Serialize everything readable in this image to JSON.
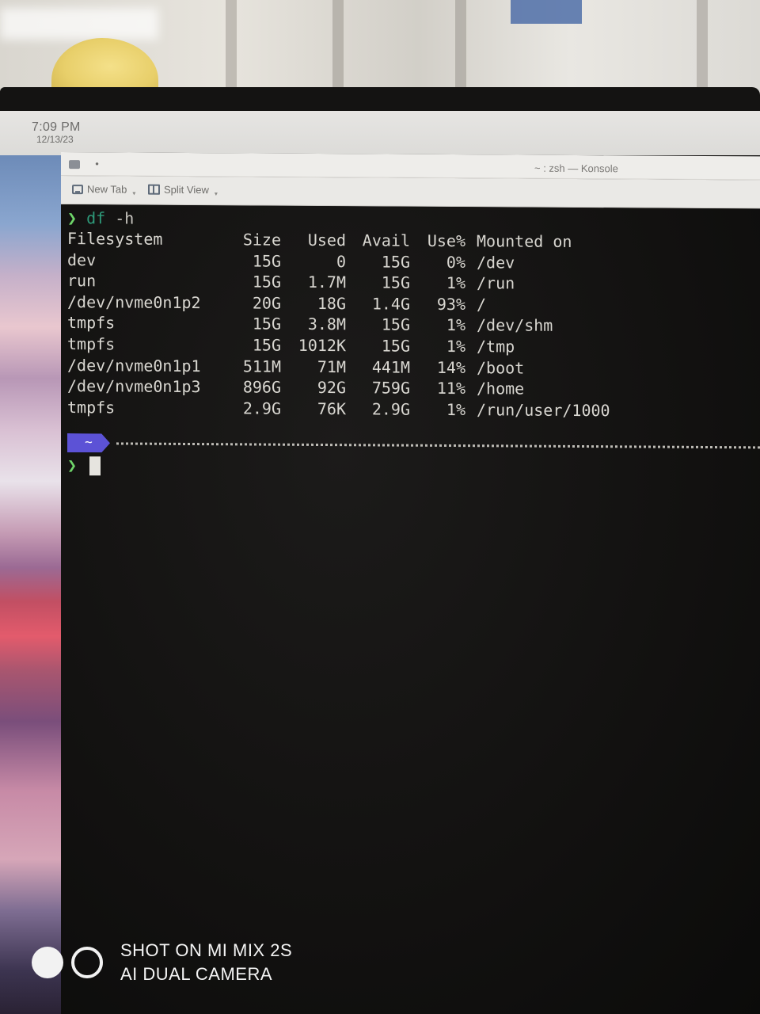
{
  "clock": {
    "time": "7:09 PM",
    "date": "12/13/23"
  },
  "window": {
    "title": "~ : zsh — Konsole"
  },
  "toolbar": {
    "new_tab": "New Tab",
    "split_view": "Split View"
  },
  "terminal": {
    "prompt_symbol": "❯",
    "command": {
      "name": "df",
      "args": "-h"
    },
    "df_header": [
      "Filesystem",
      "Size",
      "Used",
      "Avail",
      "Use%",
      "Mounted on"
    ],
    "df_rows": [
      [
        "dev",
        "15G",
        "0",
        "15G",
        "0%",
        "/dev"
      ],
      [
        "run",
        "15G",
        "1.7M",
        "15G",
        "1%",
        "/run"
      ],
      [
        "/dev/nvme0n1p2",
        "20G",
        "18G",
        "1.4G",
        "93%",
        "/"
      ],
      [
        "tmpfs",
        "15G",
        "3.8M",
        "15G",
        "1%",
        "/dev/shm"
      ],
      [
        "tmpfs",
        "15G",
        "1012K",
        "15G",
        "1%",
        "/tmp"
      ],
      [
        "/dev/nvme0n1p1",
        "511M",
        "71M",
        "441M",
        "14%",
        "/boot"
      ],
      [
        "/dev/nvme0n1p3",
        "896G",
        "92G",
        "759G",
        "11%",
        "/home"
      ],
      [
        "tmpfs",
        "2.9G",
        "76K",
        "2.9G",
        "1%",
        "/run/user/1000"
      ]
    ],
    "cwd_badge": "~",
    "prompt2_symbol": "❯"
  },
  "watermark": {
    "line1": "SHOT ON MI MIX 2S",
    "line2": "AI DUAL CAMERA"
  },
  "colors": {
    "prompt_green": "#6fd66a",
    "command_teal": "#2e9a7a",
    "badge_purple": "#5c52d6",
    "terminal_bg": "#121110"
  }
}
